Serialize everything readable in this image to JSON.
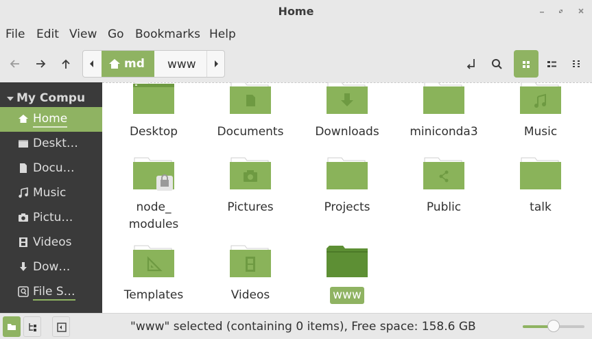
{
  "window": {
    "title": "Home"
  },
  "menu": [
    "File",
    "Edit",
    "View",
    "Go",
    "Bookmarks",
    "Help"
  ],
  "pathbar": {
    "crumbs": [
      "md",
      "www"
    ]
  },
  "sidebar": {
    "header": "My Compu",
    "items": [
      {
        "label": "Home",
        "icon": "home-icon",
        "active": true
      },
      {
        "label": "Deskt…",
        "icon": "desktop-icon"
      },
      {
        "label": "Docu…",
        "icon": "document-icon"
      },
      {
        "label": "Music",
        "icon": "music-icon"
      },
      {
        "label": "Pictu…",
        "icon": "camera-icon"
      },
      {
        "label": "Videos",
        "icon": "film-icon"
      },
      {
        "label": "Dow…",
        "icon": "download-icon"
      },
      {
        "label": "File S…",
        "icon": "filesystem-icon"
      }
    ]
  },
  "files": [
    {
      "name": "Desktop",
      "emblem": "desktop"
    },
    {
      "name": "Documents",
      "emblem": "document"
    },
    {
      "name": "Downloads",
      "emblem": "download"
    },
    {
      "name": "miniconda3",
      "emblem": "none"
    },
    {
      "name": "Music",
      "emblem": "music"
    },
    {
      "name": "node_",
      "name2": "modules",
      "emblem": "lock"
    },
    {
      "name": "Pictures",
      "emblem": "camera"
    },
    {
      "name": "Projects",
      "emblem": "none"
    },
    {
      "name": "Public",
      "emblem": "share"
    },
    {
      "name": "talk",
      "emblem": "none"
    },
    {
      "name": "Templates",
      "emblem": "template"
    },
    {
      "name": "Videos",
      "emblem": "film"
    },
    {
      "name": "www",
      "emblem": "open",
      "selected": true
    }
  ],
  "status": {
    "text": "\"www\" selected (containing 0 items), Free space: 158.6 GB",
    "zoom_level": 0.5
  },
  "colors": {
    "accent": "#8fb362",
    "folder": "#8ab35a",
    "folder_dark": "#5d8f34",
    "sidebar_bg": "#3a3a3a"
  }
}
